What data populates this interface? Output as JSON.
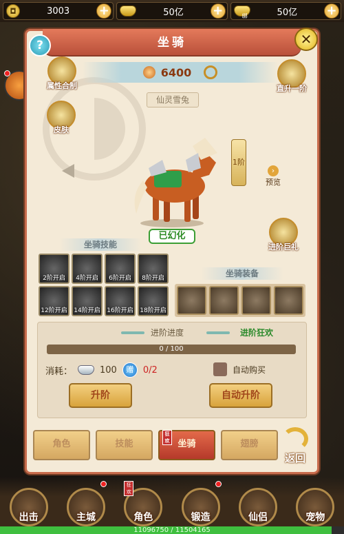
{
  "topbar": {
    "coin": "3003",
    "ingot": "50亿",
    "bound_ingot": "50亿",
    "bound_tag": "绑"
  },
  "panel": {
    "title": "坐骑",
    "close": "✕"
  },
  "power": {
    "value": "6400"
  },
  "mount": {
    "name": "仙灵雪兔",
    "status": "已幻化",
    "rank": "1阶",
    "preview": "预览"
  },
  "side": {
    "attr_label": "属性合制",
    "skin_label": "皮肤",
    "direct_label": "直升一阶",
    "gift_label": "进阶巨礼"
  },
  "sections": {
    "skills": "坐骑技能",
    "equips": "坐骑装备"
  },
  "skills": [
    "2阶开启",
    "4阶开启",
    "6阶开启",
    "8阶开启",
    "12阶开启",
    "14阶开启",
    "16阶开启",
    "18阶开启"
  ],
  "progress": {
    "title": "进阶进度",
    "status": "进阶狂欢",
    "text": "0 / 100",
    "fraction": 0
  },
  "cost": {
    "label": "消耗：",
    "silver": "100",
    "item": "0/2",
    "item_icon": "赠"
  },
  "auto_buy": "自动购买",
  "buttons": {
    "upgrade": "升阶",
    "auto_upgrade": "自动升阶"
  },
  "tabs": [
    "角色",
    "技能",
    "坐骑",
    "翅膀"
  ],
  "tab_tag": "狂欢",
  "back": "返回",
  "nav": [
    "出击",
    "主城",
    "角色",
    "锻造",
    "仙侣",
    "宠物"
  ],
  "exp": {
    "text": "11096750 / 11504165",
    "fraction": 0.9646
  }
}
